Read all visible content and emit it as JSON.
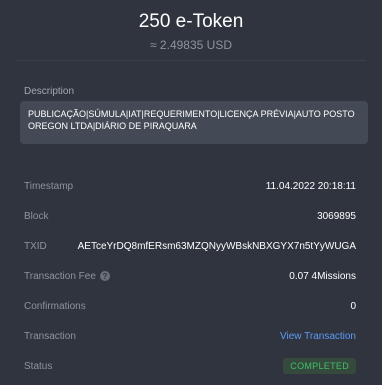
{
  "header": {
    "amount": "250 e-Token",
    "usd": "≈ 2.49835 USD"
  },
  "description": {
    "label": "Description",
    "text": "PUBLICAÇÃO|SÚMULA|IAT|REQUERIMENTO|LICENÇA PRÉVIA|AUTO POSTO OREGON LTDA|DIÁRIO DE PIRAQUARA"
  },
  "rows": {
    "timestamp": {
      "label": "Timestamp",
      "value": "11.04.2022 20:18:11"
    },
    "block": {
      "label": "Block",
      "value": "3069895"
    },
    "txid": {
      "label": "TXID",
      "value": "AETceYrDQ8mfERsm63MZQNyyWBskNBXGYX7n5tYyWUGA"
    },
    "fee": {
      "label": "Transaction Fee",
      "value": "0.07 4Missions",
      "icon": "help-icon"
    },
    "confirmations": {
      "label": "Confirmations",
      "value": "0"
    },
    "transaction": {
      "label": "Transaction",
      "value": "View Transaction"
    },
    "status": {
      "label": "Status",
      "value": "COMPLETED"
    }
  },
  "colors": {
    "background": "#2f343e",
    "link": "#5d9bf4",
    "status_green": "#3fbf6a"
  }
}
